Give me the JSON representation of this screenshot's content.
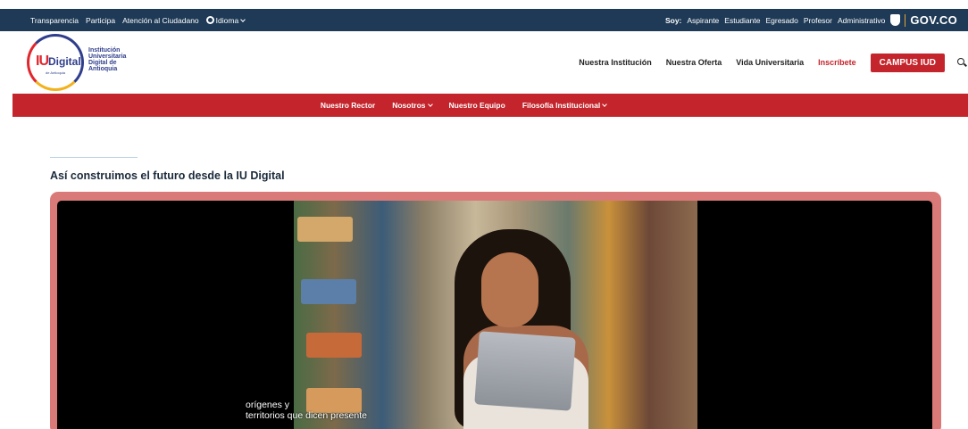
{
  "topbar": {
    "links": [
      "Transparencia",
      "Participa",
      "Atención al Ciudadano"
    ],
    "language_label": "Idioma",
    "soy_label": "Soy:",
    "roles": [
      "Aspirante",
      "Estudiante",
      "Egresado",
      "Profesor",
      "Administrativo"
    ],
    "gov_label": "GOV.CO"
  },
  "logo": {
    "iu_text": "IU",
    "digital_text": "Digital",
    "sub_text": "de Antioquia",
    "institution_lines": [
      "Institución",
      "Universitaria",
      "Digital de",
      "Antioquia"
    ]
  },
  "nav": {
    "items": [
      "Nuestra Institución",
      "Nuestra Oferta",
      "Vida Universitaria"
    ],
    "inscribete": "Inscríbete",
    "campus": "CAMPUS IUD"
  },
  "subnav": {
    "items": [
      "Nuestro Rector",
      "Nosotros",
      "Nuestro Equipo",
      "Filosofía Institucional"
    ]
  },
  "section": {
    "heading": "Así construimos el futuro desde la IU Digital"
  },
  "video": {
    "caption_line1": "orígenes y",
    "caption_line2": "territorios que dicen presente"
  },
  "colors": {
    "topbar_bg": "#1f3a56",
    "accent_red": "#c4242b",
    "frame_pink": "#d97a78",
    "brand_blue": "#2f3e8c"
  }
}
